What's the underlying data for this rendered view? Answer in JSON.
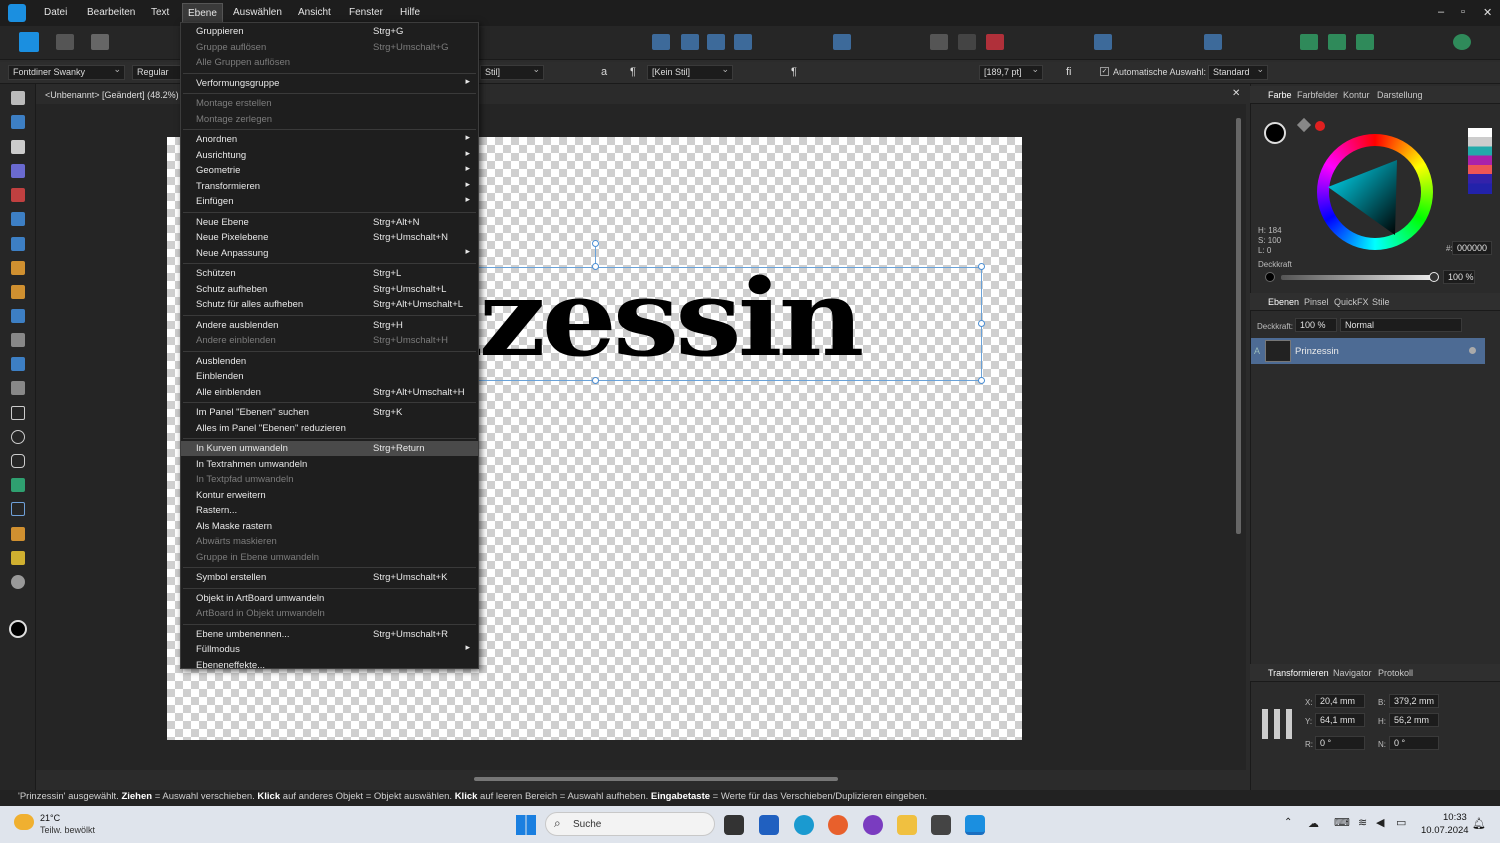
{
  "menubar": {
    "items": [
      "Datei",
      "Bearbeiten",
      "Text",
      "Ebene",
      "Auswählen",
      "Ansicht",
      "Fenster",
      "Hilfe"
    ],
    "active_index": 3,
    "window_controls": {
      "minimize": "–",
      "restore": "▫",
      "close": "✕"
    }
  },
  "context": {
    "font": "Fontdiner Swanky",
    "style": "Regular",
    "para_style": "Stil]",
    "char_a": "a",
    "pilcrow": "¶",
    "char_style": "[Kein Stil]",
    "pilcrow2": "¶",
    "size": "[189,7 pt]",
    "ligature": "fi",
    "auto_select_label": "Automatische Auswahl:",
    "auto_select_value": "Standard"
  },
  "document": {
    "tab_title": "<Unbenannt> [Geändert] (48.2%)",
    "close": "✕",
    "text_content": "nzessin"
  },
  "layer_menu": {
    "items": [
      {
        "label": "Gruppieren",
        "shortcut": "Strg+G",
        "disabled": false
      },
      {
        "label": "Gruppe auflösen",
        "shortcut": "Strg+Umschalt+G",
        "disabled": true
      },
      {
        "label": "Alle Gruppen auflösen",
        "shortcut": "",
        "disabled": true
      },
      {
        "sep": true
      },
      {
        "label": "Verformungsgruppe",
        "shortcut": "",
        "submenu": true
      },
      {
        "sep": true
      },
      {
        "label": "Montage erstellen",
        "shortcut": "",
        "disabled": true
      },
      {
        "label": "Montage zerlegen",
        "shortcut": "",
        "disabled": true
      },
      {
        "sep": true
      },
      {
        "label": "Anordnen",
        "shortcut": "",
        "submenu": true
      },
      {
        "label": "Ausrichtung",
        "shortcut": "",
        "submenu": true
      },
      {
        "label": "Geometrie",
        "shortcut": "",
        "submenu": true
      },
      {
        "label": "Transformieren",
        "shortcut": "",
        "submenu": true
      },
      {
        "label": "Einfügen",
        "shortcut": "",
        "submenu": true
      },
      {
        "sep": true
      },
      {
        "label": "Neue Ebene",
        "shortcut": "Strg+Alt+N"
      },
      {
        "label": "Neue Pixelebene",
        "shortcut": "Strg+Umschalt+N"
      },
      {
        "label": "Neue Anpassung",
        "shortcut": "",
        "submenu": true
      },
      {
        "sep": true
      },
      {
        "label": "Schützen",
        "shortcut": "Strg+L"
      },
      {
        "label": "Schutz aufheben",
        "shortcut": "Strg+Umschalt+L"
      },
      {
        "label": "Schutz für alles aufheben",
        "shortcut": "Strg+Alt+Umschalt+L"
      },
      {
        "sep": true
      },
      {
        "label": "Andere ausblenden",
        "shortcut": "Strg+H"
      },
      {
        "label": "Andere einblenden",
        "shortcut": "Strg+Umschalt+H",
        "disabled": true
      },
      {
        "sep": true
      },
      {
        "label": "Ausblenden",
        "shortcut": ""
      },
      {
        "label": "Einblenden",
        "shortcut": ""
      },
      {
        "label": "Alle einblenden",
        "shortcut": "Strg+Alt+Umschalt+H"
      },
      {
        "sep": true
      },
      {
        "label": "Im Panel \"Ebenen\" suchen",
        "shortcut": "Strg+K"
      },
      {
        "label": "Alles im Panel \"Ebenen\" reduzieren",
        "shortcut": ""
      },
      {
        "sep": true
      },
      {
        "label": "In Kurven umwandeln",
        "shortcut": "Strg+Return",
        "highlight": true
      },
      {
        "label": "In Textrahmen umwandeln",
        "shortcut": ""
      },
      {
        "label": "In Textpfad umwandeln",
        "shortcut": "",
        "disabled": true
      },
      {
        "label": "Kontur erweitern",
        "shortcut": ""
      },
      {
        "label": "Rastern...",
        "shortcut": ""
      },
      {
        "label": "Als Maske rastern",
        "shortcut": ""
      },
      {
        "label": "Abwärts maskieren",
        "shortcut": "",
        "disabled": true
      },
      {
        "label": "Gruppe in Ebene umwandeln",
        "shortcut": "",
        "disabled": true
      },
      {
        "sep": true
      },
      {
        "label": "Symbol erstellen",
        "shortcut": "Strg+Umschalt+K"
      },
      {
        "sep": true
      },
      {
        "label": "Objekt in ArtBoard umwandeln",
        "shortcut": ""
      },
      {
        "label": "ArtBoard in Objekt umwandeln",
        "shortcut": "",
        "disabled": true
      },
      {
        "sep": true
      },
      {
        "label": "Ebene umbenennen...",
        "shortcut": "Strg+Umschalt+R"
      },
      {
        "label": "Füllmodus",
        "shortcut": "",
        "submenu": true
      },
      {
        "label": "Ebeneneffekte...",
        "shortcut": ""
      }
    ]
  },
  "color_panel": {
    "tabs": [
      "Farbe",
      "Farbfelder",
      "Kontur",
      "Darstellung"
    ],
    "h": "H: 184",
    "s": "S: 100",
    "l": "L: 0",
    "hex_label": "#:",
    "hex": "000000",
    "opacity_label": "Deckkraft",
    "opacity": "100 %"
  },
  "layers_panel": {
    "tabs": [
      "Ebenen",
      "Pinsel",
      "QuickFX",
      "Stile"
    ],
    "opacity_label": "Deckkraft:",
    "opacity": "100 %",
    "blend": "Normal",
    "layer_type": "A",
    "layer_name": "Prinzessin"
  },
  "transform_panel": {
    "tabs": [
      "Transformieren",
      "Navigator",
      "Protokoll"
    ],
    "x_label": "X:",
    "x": "20,4 mm",
    "y_label": "Y:",
    "y": "64,1 mm",
    "b_label": "B:",
    "b": "379,2 mm",
    "h_label": "H:",
    "h": "56,2 mm",
    "r_label": "R:",
    "r": "0 °",
    "n_label": "N:",
    "n": "0 °"
  },
  "status": {
    "p1": "'Prinzessin' ausgewählt. ",
    "b1": "Ziehen",
    "p2": " = Auswahl verschieben. ",
    "b2": "Klick",
    "p3": " auf anderes Objekt = Objekt auswählen. ",
    "b3": "Klick",
    "p4": " auf leeren Bereich = Auswahl aufheben. ",
    "b4": "Eingabetaste",
    "p5": " = Werte für das Verschieben/Duplizieren eingeben."
  },
  "taskbar": {
    "temp": "21°C",
    "weather": "Teilw. bewölkt",
    "search": "Suche",
    "time": "10:33",
    "date": "10.07.2024"
  },
  "colors": {
    "accent": "#1b8fe0",
    "layer_selected": "#4d6b94",
    "menu_highlight": "#4a4a4a"
  }
}
